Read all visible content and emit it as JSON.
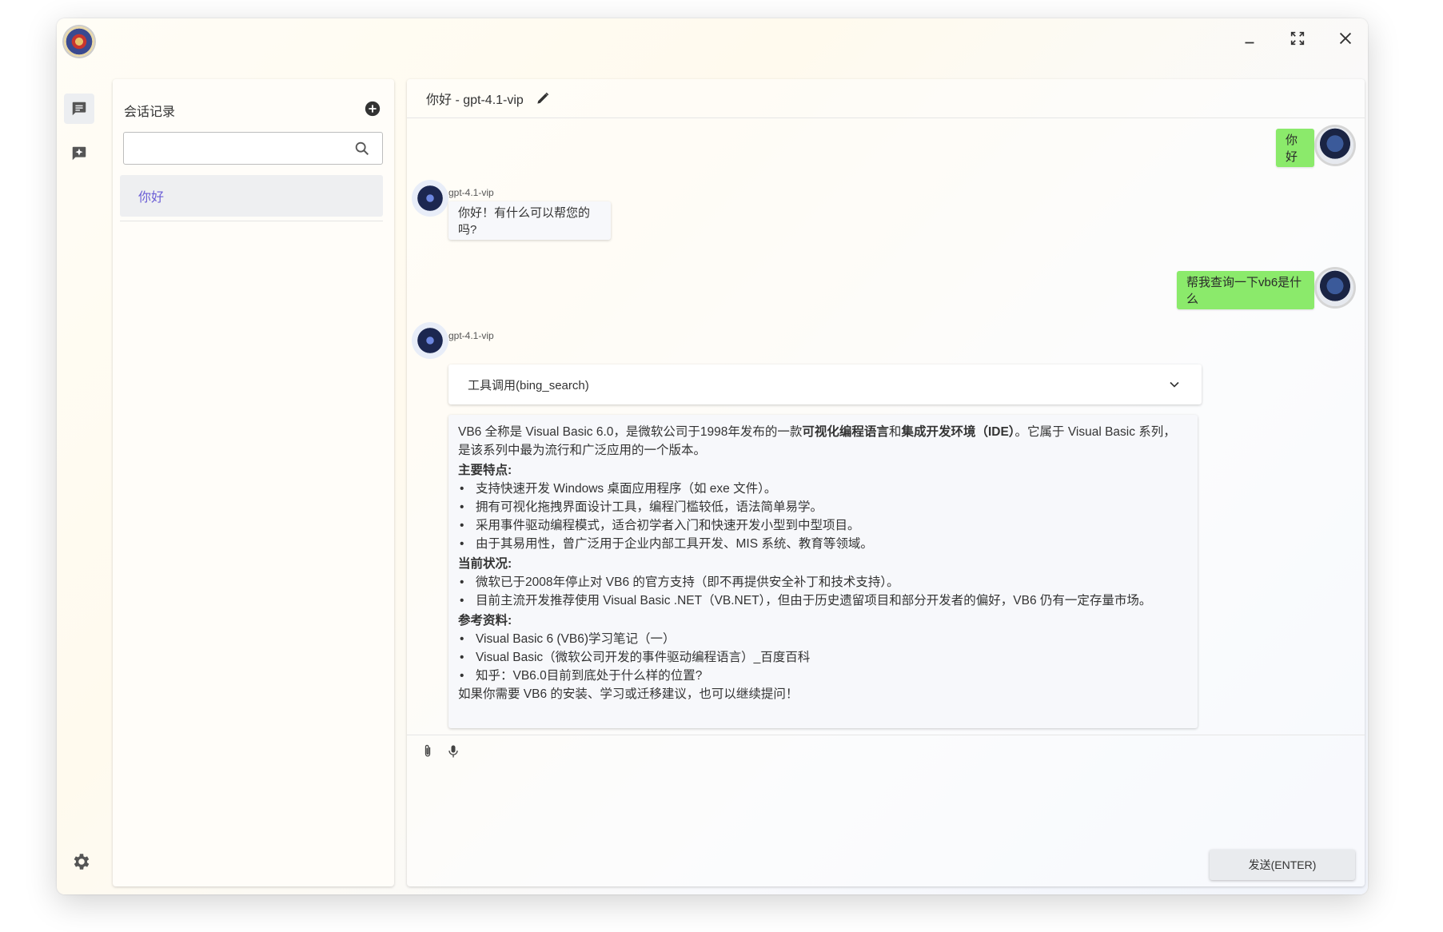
{
  "window": {
    "controls": [
      "minimize-icon",
      "fullscreen-icon",
      "close-icon"
    ]
  },
  "sessions": {
    "title": "会话记录",
    "search_placeholder": "",
    "items": [
      {
        "label": "你好"
      }
    ]
  },
  "chat": {
    "title": "你好 - gpt-4.1-vip",
    "messages": [
      {
        "role": "user",
        "text": "你好"
      },
      {
        "role": "bot",
        "name": "gpt-4.1-vip",
        "text": "你好！有什么可以帮您的吗?"
      },
      {
        "role": "user",
        "text": "帮我查询一下vb6是什么"
      },
      {
        "role": "bot",
        "name": "gpt-4.1-vip"
      }
    ],
    "tool_call": "工具调用(bing_search)",
    "answer": {
      "intro_a": "VB6 全称是 Visual Basic 6.0，是微软公司于1998年发布的一款",
      "intro_b1": "可视化编程语言",
      "intro_and": "和",
      "intro_b2": "集成开发环境（IDE）",
      "intro_c": "。它属于 Visual Basic 系列，是该系列中最为流行和广泛应用的一个版本。",
      "features_title": "主要特点:",
      "features": [
        "支持快速开发 Windows 桌面应用程序（如 exe 文件）。",
        "拥有可视化拖拽界面设计工具，编程门槛较低，语法简单易学。",
        "采用事件驱动编程模式，适合初学者入门和快速开发小型到中型项目。",
        "由于其易用性，曾广泛用于企业内部工具开发、MIS 系统、教育等领域。"
      ],
      "status_title": "当前状况:",
      "status": [
        "微软已于2008年停止对 VB6 的官方支持（即不再提供安全补丁和技术支持）。",
        "目前主流开发推荐使用 Visual Basic .NET（VB.NET），但由于历史遗留项目和部分开发者的偏好，VB6 仍有一定存量市场。"
      ],
      "refs_title": "参考资料:",
      "refs": [
        "Visual Basic 6 (VB6)学习笔记（一）",
        "Visual Basic（微软公司开发的事件驱动编程语言）_百度百科",
        "知乎：VB6.0目前到底处于什么样的位置?"
      ],
      "outro": "如果你需要 VB6 的安装、学习或迁移建议，也可以继续提问！"
    },
    "input_placeholder": "",
    "send_label": "发送(ENTER)"
  }
}
